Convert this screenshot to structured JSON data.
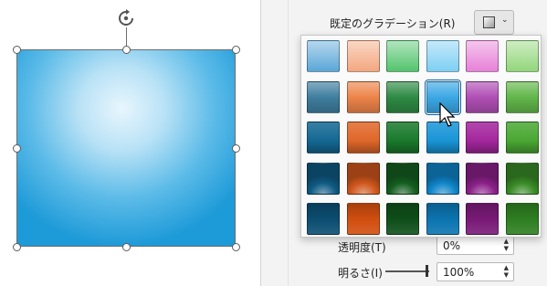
{
  "format_pane": {
    "preset_gradients": {
      "label": "既定のグラデーション(R)",
      "button_icon": "gradient-swatch-icon",
      "dropdown_icon": "chevron-down-icon"
    },
    "transparency": {
      "label": "透明度(T)",
      "value": "0%"
    },
    "brightness": {
      "label": "明るさ(I)",
      "value": "100%"
    }
  },
  "gallery": {
    "hovered": "2-4",
    "rows": [
      {
        "variant": "light",
        "colors": [
          "#5aa7d8",
          "#f3a77f",
          "#52c46c",
          "#7dcff3",
          "#e780d8",
          "#92d67a"
        ]
      },
      {
        "variant": "mid",
        "colors": [
          "#3f7e9f",
          "#ed844a",
          "#2e8a44",
          "#3ba8e5",
          "#b04fb5",
          "#62b64a"
        ]
      },
      {
        "variant": "dark",
        "colors": [
          "#146894",
          "#e0672a",
          "#1a7a2c",
          "#1995d7",
          "#a4279e",
          "#4aa833"
        ]
      },
      {
        "variant": "radial",
        "colors": [
          "#0f5a82",
          "#d0561c",
          "#145e20",
          "#0f84c8",
          "#8a2088",
          "#388a26"
        ]
      },
      {
        "variant": "deep",
        "colors": [
          "#0c4e72",
          "#d24f10",
          "#0f4f1a",
          "#0c75b1",
          "#7a1a78",
          "#2f7f22"
        ]
      }
    ]
  }
}
